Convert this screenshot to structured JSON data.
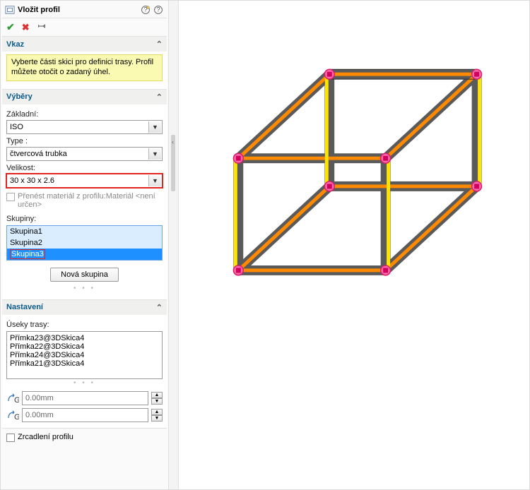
{
  "header": {
    "title": "Vložit profil"
  },
  "section_vkaz": {
    "title": "Vkaz",
    "message": "Vyberte části skici pro definici trasy. Profil můžete otočit o zadaný úhel."
  },
  "section_vybery": {
    "title": "Výběry",
    "zakladni_label": "Základní:",
    "zakladni_value": "ISO",
    "type_label": "Type :",
    "type_value": "čtvercová trubka",
    "velikost_label": "Velikost:",
    "velikost_value": "30 x 30 x 2.6",
    "prenest_label": "Přenést materiál z profilu:Materiál <není určen>",
    "skupiny_label": "Skupiny:",
    "skupiny_items": [
      "Skupina1",
      "Skupina2",
      "Skupina3"
    ],
    "nova_skupina_btn": "Nová skupina"
  },
  "section_nastaveni": {
    "title": "Nastavení",
    "useky_label": "Úseky trasy:",
    "useky_items": [
      "Přímka23@3DSkica4",
      "Přímka22@3DSkica4",
      "Přímka24@3DSkica4",
      "Přímka21@3DSkica4"
    ],
    "g1_value": "0.00mm",
    "g2_value": "0.00mm"
  },
  "mirror": {
    "label": "Zrcadlení profilu"
  }
}
